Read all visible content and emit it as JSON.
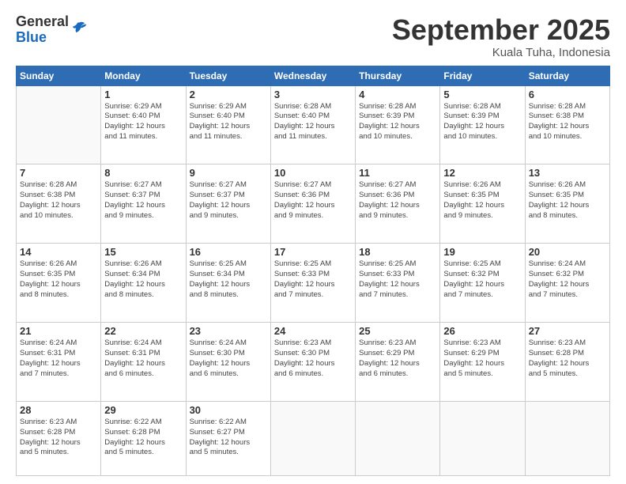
{
  "header": {
    "logo": {
      "line1": "General",
      "line2": "Blue"
    },
    "title": "September 2025",
    "location": "Kuala Tuha, Indonesia"
  },
  "days_of_week": [
    "Sunday",
    "Monday",
    "Tuesday",
    "Wednesday",
    "Thursday",
    "Friday",
    "Saturday"
  ],
  "weeks": [
    [
      {
        "day": "",
        "info": ""
      },
      {
        "day": "1",
        "info": "Sunrise: 6:29 AM\nSunset: 6:40 PM\nDaylight: 12 hours\nand 11 minutes."
      },
      {
        "day": "2",
        "info": "Sunrise: 6:29 AM\nSunset: 6:40 PM\nDaylight: 12 hours\nand 11 minutes."
      },
      {
        "day": "3",
        "info": "Sunrise: 6:28 AM\nSunset: 6:40 PM\nDaylight: 12 hours\nand 11 minutes."
      },
      {
        "day": "4",
        "info": "Sunrise: 6:28 AM\nSunset: 6:39 PM\nDaylight: 12 hours\nand 10 minutes."
      },
      {
        "day": "5",
        "info": "Sunrise: 6:28 AM\nSunset: 6:39 PM\nDaylight: 12 hours\nand 10 minutes."
      },
      {
        "day": "6",
        "info": "Sunrise: 6:28 AM\nSunset: 6:38 PM\nDaylight: 12 hours\nand 10 minutes."
      }
    ],
    [
      {
        "day": "7",
        "info": "Sunrise: 6:28 AM\nSunset: 6:38 PM\nDaylight: 12 hours\nand 10 minutes."
      },
      {
        "day": "8",
        "info": "Sunrise: 6:27 AM\nSunset: 6:37 PM\nDaylight: 12 hours\nand 9 minutes."
      },
      {
        "day": "9",
        "info": "Sunrise: 6:27 AM\nSunset: 6:37 PM\nDaylight: 12 hours\nand 9 minutes."
      },
      {
        "day": "10",
        "info": "Sunrise: 6:27 AM\nSunset: 6:36 PM\nDaylight: 12 hours\nand 9 minutes."
      },
      {
        "day": "11",
        "info": "Sunrise: 6:27 AM\nSunset: 6:36 PM\nDaylight: 12 hours\nand 9 minutes."
      },
      {
        "day": "12",
        "info": "Sunrise: 6:26 AM\nSunset: 6:35 PM\nDaylight: 12 hours\nand 9 minutes."
      },
      {
        "day": "13",
        "info": "Sunrise: 6:26 AM\nSunset: 6:35 PM\nDaylight: 12 hours\nand 8 minutes."
      }
    ],
    [
      {
        "day": "14",
        "info": "Sunrise: 6:26 AM\nSunset: 6:35 PM\nDaylight: 12 hours\nand 8 minutes."
      },
      {
        "day": "15",
        "info": "Sunrise: 6:26 AM\nSunset: 6:34 PM\nDaylight: 12 hours\nand 8 minutes."
      },
      {
        "day": "16",
        "info": "Sunrise: 6:25 AM\nSunset: 6:34 PM\nDaylight: 12 hours\nand 8 minutes."
      },
      {
        "day": "17",
        "info": "Sunrise: 6:25 AM\nSunset: 6:33 PM\nDaylight: 12 hours\nand 7 minutes."
      },
      {
        "day": "18",
        "info": "Sunrise: 6:25 AM\nSunset: 6:33 PM\nDaylight: 12 hours\nand 7 minutes."
      },
      {
        "day": "19",
        "info": "Sunrise: 6:25 AM\nSunset: 6:32 PM\nDaylight: 12 hours\nand 7 minutes."
      },
      {
        "day": "20",
        "info": "Sunrise: 6:24 AM\nSunset: 6:32 PM\nDaylight: 12 hours\nand 7 minutes."
      }
    ],
    [
      {
        "day": "21",
        "info": "Sunrise: 6:24 AM\nSunset: 6:31 PM\nDaylight: 12 hours\nand 7 minutes."
      },
      {
        "day": "22",
        "info": "Sunrise: 6:24 AM\nSunset: 6:31 PM\nDaylight: 12 hours\nand 6 minutes."
      },
      {
        "day": "23",
        "info": "Sunrise: 6:24 AM\nSunset: 6:30 PM\nDaylight: 12 hours\nand 6 minutes."
      },
      {
        "day": "24",
        "info": "Sunrise: 6:23 AM\nSunset: 6:30 PM\nDaylight: 12 hours\nand 6 minutes."
      },
      {
        "day": "25",
        "info": "Sunrise: 6:23 AM\nSunset: 6:29 PM\nDaylight: 12 hours\nand 6 minutes."
      },
      {
        "day": "26",
        "info": "Sunrise: 6:23 AM\nSunset: 6:29 PM\nDaylight: 12 hours\nand 5 minutes."
      },
      {
        "day": "27",
        "info": "Sunrise: 6:23 AM\nSunset: 6:28 PM\nDaylight: 12 hours\nand 5 minutes."
      }
    ],
    [
      {
        "day": "28",
        "info": "Sunrise: 6:23 AM\nSunset: 6:28 PM\nDaylight: 12 hours\nand 5 minutes."
      },
      {
        "day": "29",
        "info": "Sunrise: 6:22 AM\nSunset: 6:28 PM\nDaylight: 12 hours\nand 5 minutes."
      },
      {
        "day": "30",
        "info": "Sunrise: 6:22 AM\nSunset: 6:27 PM\nDaylight: 12 hours\nand 5 minutes."
      },
      {
        "day": "",
        "info": ""
      },
      {
        "day": "",
        "info": ""
      },
      {
        "day": "",
        "info": ""
      },
      {
        "day": "",
        "info": ""
      }
    ]
  ]
}
